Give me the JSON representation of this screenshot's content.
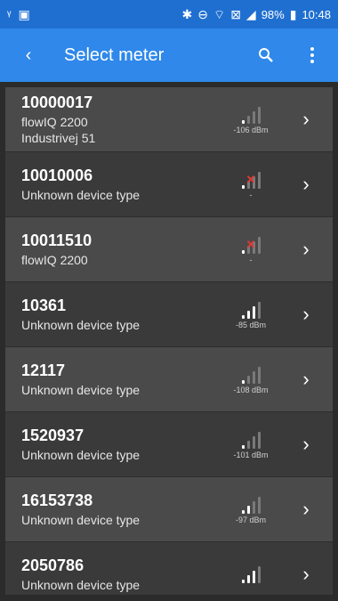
{
  "status_bar": {
    "battery": "98%",
    "time": "10:48"
  },
  "app_bar": {
    "title": "Select meter"
  },
  "meters": [
    {
      "id": "10000017",
      "type": "flowIQ 2200",
      "address": "Industrivej 51",
      "signal_bars": 1,
      "no_signal": false,
      "dbm": "-106 dBm"
    },
    {
      "id": "10010006",
      "type": "Unknown device type",
      "address": "",
      "signal_bars": 1,
      "no_signal": true,
      "dbm": "-"
    },
    {
      "id": "10011510",
      "type": "flowIQ 2200",
      "address": "",
      "signal_bars": 1,
      "no_signal": true,
      "dbm": "-"
    },
    {
      "id": "10361",
      "type": "Unknown device type",
      "address": "",
      "signal_bars": 3,
      "no_signal": false,
      "dbm": "-85 dBm"
    },
    {
      "id": "12117",
      "type": "Unknown device type",
      "address": "",
      "signal_bars": 1,
      "no_signal": false,
      "dbm": "-108 dBm"
    },
    {
      "id": "1520937",
      "type": "Unknown device type",
      "address": "",
      "signal_bars": 1,
      "no_signal": false,
      "dbm": "-101 dBm"
    },
    {
      "id": "16153738",
      "type": "Unknown device type",
      "address": "",
      "signal_bars": 2,
      "no_signal": false,
      "dbm": "-97 dBm"
    },
    {
      "id": "2050786",
      "type": "Unknown device type",
      "address": "",
      "signal_bars": 3,
      "no_signal": false,
      "dbm": ""
    }
  ],
  "colors": {
    "status_bar": "#1f6fd1",
    "app_bar": "#2f88ea",
    "row_light": "#4a4a4a",
    "row_dark": "#3a3a3a",
    "no_signal": "#e53935"
  },
  "icons": {
    "back": "chevron-left-icon",
    "search": "search-icon",
    "menu": "more-vert-icon",
    "row": "chevron-right-icon"
  }
}
